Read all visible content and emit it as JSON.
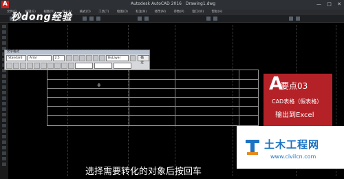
{
  "window": {
    "title_app": "Autodesk AutoCAD 2016",
    "title_file": "Drawing1.dwg",
    "controls": [
      "—",
      "□",
      "✕"
    ]
  },
  "menubar": {
    "items": [
      "文件(F)",
      "编辑(E)",
      "视图(V)",
      "插入(I)",
      "格式(O)",
      "工具(T)",
      "绘图(D)",
      "标注(N)",
      "修改(M)",
      "参数(P)",
      "窗口(W)",
      "帮助(H)"
    ]
  },
  "watermark": {
    "text": "秒dong经验"
  },
  "text_format": {
    "header": "文字格式",
    "style_value": "Standard",
    "font_value": "Arial",
    "height_value": "2.5",
    "color_value": "ByLayer",
    "ok_label": "确定"
  },
  "badge": {
    "logo": "A",
    "title": "要点03",
    "line1": "CAD表格（假表格）",
    "line2": "输出到Excel",
    "color": "#b42228"
  },
  "brand": {
    "name": "土木工程网",
    "url": "www.civilcn.com",
    "color": "#1b73c2"
  },
  "subtitle": {
    "text": "选择需要转化的对象后按回车"
  }
}
